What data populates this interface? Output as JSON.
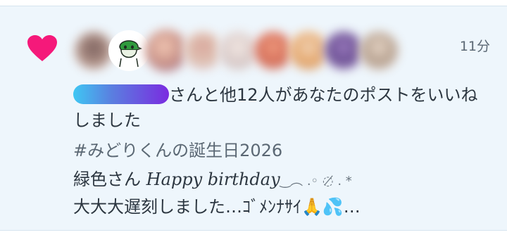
{
  "notification": {
    "time": "11分",
    "liked_text": "さんと他12人があなたのポストをいいねしました",
    "hashtag": "#みどりくんの誕生日2026",
    "post_line1_prefix": "緑色さん ",
    "post_line1_italic": "Happy birthday",
    "post_line1_deco": "‿︵ .◦ ◌̸ . *",
    "post_line2": "大大大遅刻しました…ｺﾞﾒﾝﾅｻｲ🙏💦…"
  },
  "icons": {
    "like": "heart-icon",
    "avatar_shown": "green-character-avatar",
    "accent_color": "#f5197a"
  }
}
